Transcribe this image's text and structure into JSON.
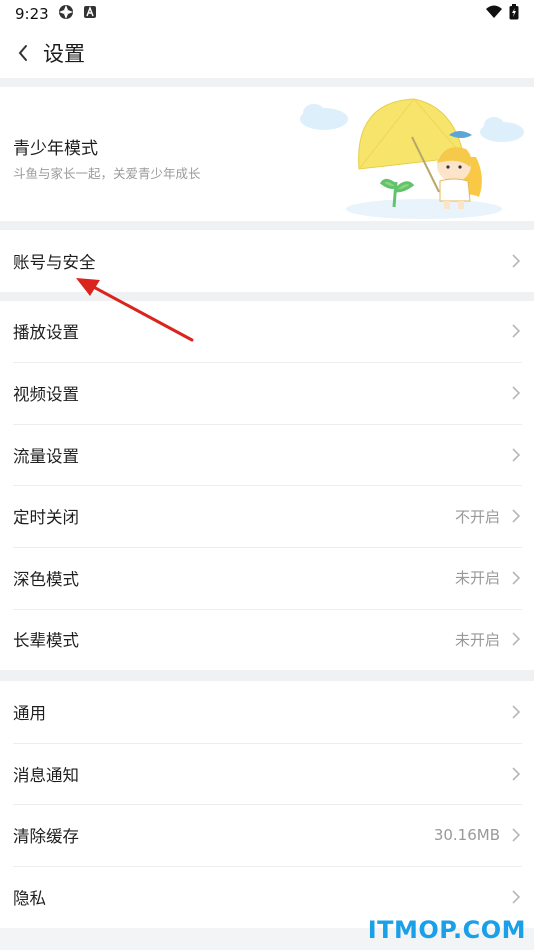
{
  "status_bar": {
    "time": "9:23"
  },
  "header": {
    "title": "设置"
  },
  "teen_mode": {
    "title": "青少年模式",
    "subtitle": "斗鱼与家长一起，关爱青少年成长"
  },
  "account": {
    "label": "账号与安全"
  },
  "playback_section": [
    {
      "label": "播放设置",
      "value": ""
    },
    {
      "label": "视频设置",
      "value": ""
    },
    {
      "label": "流量设置",
      "value": ""
    },
    {
      "label": "定时关闭",
      "value": "不开启"
    },
    {
      "label": "深色模式",
      "value": "未开启"
    },
    {
      "label": "长辈模式",
      "value": "未开启"
    }
  ],
  "general_section": [
    {
      "label": "通用",
      "value": ""
    },
    {
      "label": "消息通知",
      "value": ""
    },
    {
      "label": "清除缓存",
      "value": "30.16MB"
    },
    {
      "label": "隐私",
      "value": ""
    }
  ],
  "watermark": "ITMOP.COM",
  "colors": {
    "accent_arrow": "#d9251d",
    "watermark": "#1aa0e8",
    "umbrella": "#f7e46a"
  }
}
